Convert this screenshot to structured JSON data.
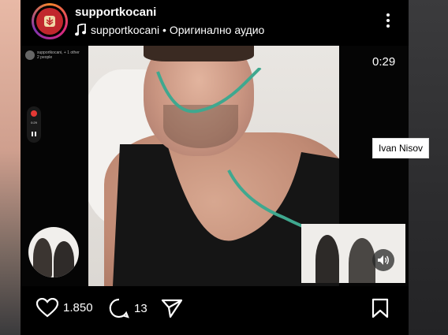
{
  "header": {
    "username": "supportkocani",
    "avatar_initial": "ᛉ",
    "audio_label": "supportkocani • Оригинално аудио",
    "music_icon": "music-note-icon",
    "more_icon": "more-vertical-icon"
  },
  "video": {
    "call_title": "supportkocani, + 1 other",
    "call_subtitle": "2 people",
    "rec_time": "0:29",
    "time_remaining": "0:29",
    "sound_icon": "speaker-icon"
  },
  "actions": {
    "likes": "1.850",
    "comments": "13",
    "like_icon": "heart-icon",
    "comment_icon": "comment-icon",
    "share_icon": "send-icon",
    "save_icon": "bookmark-icon"
  },
  "overlay_tag": {
    "label": "Ivan Nisov"
  },
  "colors": {
    "background": "#000000",
    "text": "#ffffff",
    "record_red": "#e53935",
    "tube_green": "#3fa88f"
  }
}
